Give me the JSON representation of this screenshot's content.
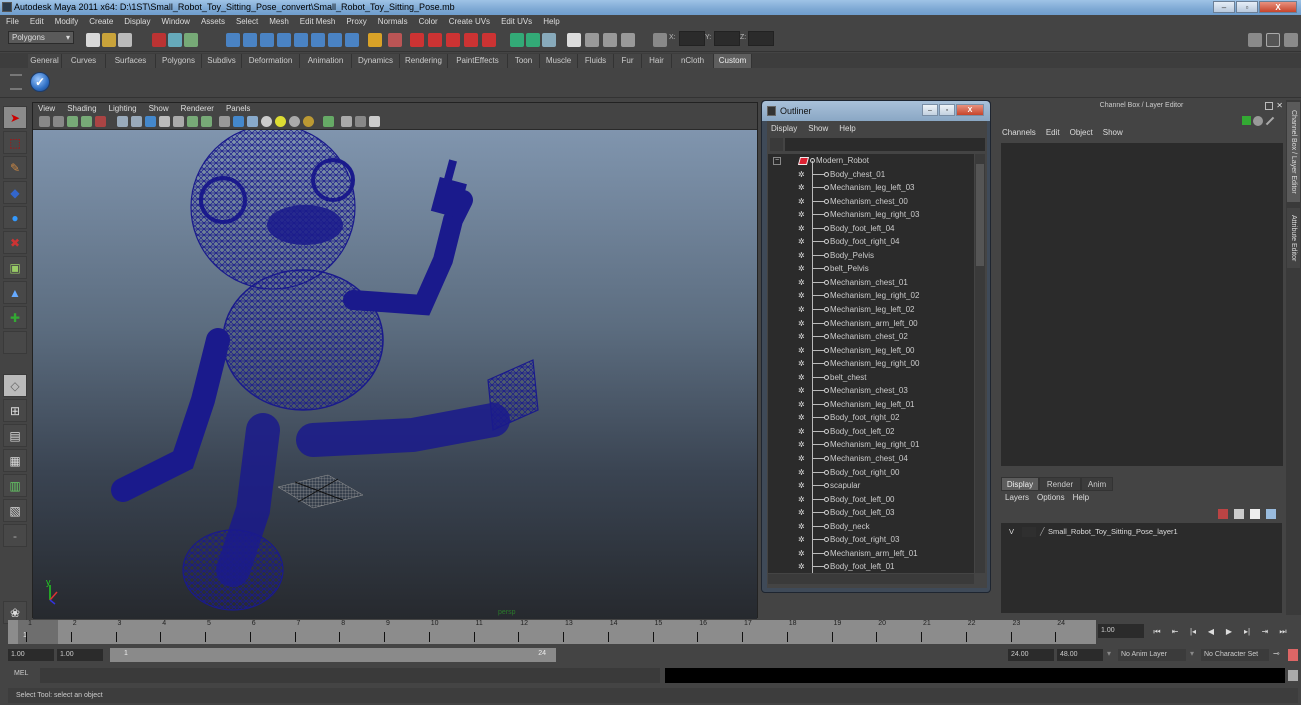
{
  "window": {
    "title": "Autodesk Maya 2011 x64: D:\\1ST\\Small_Robot_Toy_Sitting_Pose_convert\\Small_Robot_Toy_Sitting_Pose.mb",
    "minimize": "–",
    "maximize": "▫",
    "close": "X"
  },
  "menubar": [
    "File",
    "Edit",
    "Modify",
    "Create",
    "Display",
    "Window",
    "Assets",
    "Select",
    "Mesh",
    "Edit Mesh",
    "Proxy",
    "Normals",
    "Color",
    "Create UVs",
    "Edit UVs",
    "Help"
  ],
  "statusline": {
    "mode": "Polygons",
    "coord_labels": {
      "x": "X:",
      "y": "Y:",
      "z": "Z:"
    },
    "coord_values": {
      "x": "",
      "y": "",
      "z": ""
    }
  },
  "shelf": {
    "tabs": [
      "General",
      "Curves",
      "Surfaces",
      "Polygons",
      "Subdivs",
      "Deformation",
      "Animation",
      "Dynamics",
      "Rendering",
      "PaintEffects",
      "Toon",
      "Muscle",
      "Fluids",
      "Fur",
      "Hair",
      "nCloth",
      "Custom"
    ],
    "active_tab": "Custom"
  },
  "toolbox": {
    "tools": [
      "select-tool",
      "lasso-tool",
      "paint-select-tool",
      "move-tool",
      "rotate-tool",
      "scale-tool",
      "universal-manipulator",
      "soft-mod-tool",
      "show-manipulator",
      "last-tool"
    ],
    "layouts": [
      "single-perspective",
      "four-view",
      "persp-outliner",
      "persp-graph",
      "persp-hypershade",
      "persp-graph-hypershade",
      "layout-options"
    ],
    "selected": "select-tool"
  },
  "viewport": {
    "menu": [
      "View",
      "Shading",
      "Lighting",
      "Show",
      "Renderer",
      "Panels"
    ],
    "camera_label": "persp",
    "axis": {
      "y": "y",
      "x": "x",
      "z": "z"
    },
    "wireframe_color": "#1a1a8c"
  },
  "outliner": {
    "title": "Outliner",
    "menu": [
      "Display",
      "Show",
      "Help"
    ],
    "filter": "",
    "root": "Modern_Robot",
    "items": [
      "Body_chest_01",
      "Mechanism_leg_left_03",
      "Mechanism_chest_00",
      "Mechanism_leg_right_03",
      "Body_foot_left_04",
      "Body_foot_right_04",
      "Body_Pelvis",
      "belt_Pelvis",
      "Mechanism_chest_01",
      "Mechanism_leg_right_02",
      "Mechanism_leg_left_02",
      "Mechanism_arm_left_00",
      "Mechanism_chest_02",
      "Mechanism_leg_left_00",
      "Mechanism_leg_right_00",
      "belt_chest",
      "Mechanism_chest_03",
      "Mechanism_leg_left_01",
      "Body_foot_right_02",
      "Body_foot_left_02",
      "Mechanism_leg_right_01",
      "Mechanism_chest_04",
      "Body_foot_right_00",
      "scapular",
      "Body_foot_left_00",
      "Body_foot_left_03",
      "Body_neck",
      "Body_foot_right_03",
      "Mechanism_arm_left_01",
      "Body_foot_left_01"
    ]
  },
  "channelbox": {
    "title": "Channel Box / Layer Editor",
    "menu": [
      "Channels",
      "Edit",
      "Object",
      "Show"
    ]
  },
  "layereditor": {
    "tabs": [
      "Display",
      "Render",
      "Anim"
    ],
    "active_tab": "Display",
    "menu": [
      "Layers",
      "Options",
      "Help"
    ],
    "layers": [
      {
        "visible": "V",
        "name": "Small_Robot_Toy_Sitting_Pose_layer1"
      }
    ]
  },
  "sidetabs": [
    "Channel Box / Layer Editor",
    "Attribute Editor"
  ],
  "timeline": {
    "ticks": [
      "1",
      "2",
      "3",
      "4",
      "5",
      "6",
      "7",
      "8",
      "9",
      "10",
      "11",
      "12",
      "13",
      "14",
      "15",
      "16",
      "17",
      "18",
      "19",
      "20",
      "21",
      "22",
      "23",
      "24"
    ],
    "current_frame": "1",
    "current_time_field": "1.00",
    "playback_buttons": [
      "⏮",
      "⇤",
      "|◂",
      "◀",
      "▶",
      "▸|",
      "⇥",
      "⏭"
    ]
  },
  "range": {
    "start_time": "1.00",
    "playback_start": "1.00",
    "range_start_label": "1",
    "range_end_label": "24",
    "playback_end": "24.00",
    "end_time": "48.00",
    "anim_layer": "No Anim Layer",
    "character_set": "No Character Set"
  },
  "cmdline": {
    "label": "MEL",
    "input": "",
    "result": ""
  },
  "helpline": "Select Tool: select an object"
}
